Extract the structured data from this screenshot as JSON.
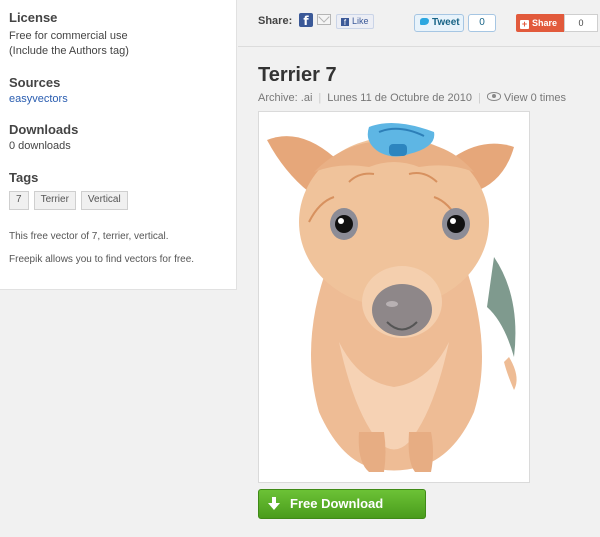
{
  "sidebar": {
    "license": {
      "heading": "License",
      "line1": "Free for commercial use",
      "line2": "(Include the Authors tag)"
    },
    "sources": {
      "heading": "Sources",
      "link": "easyvectors"
    },
    "downloads": {
      "heading": "Downloads",
      "count": "0 downloads"
    },
    "tags": {
      "heading": "Tags",
      "items": [
        "7",
        "Terrier",
        "Vertical"
      ]
    },
    "description": "This free vector of 7, terrier, vertical.",
    "promo": "Freepik allows you to find vectors for free."
  },
  "share": {
    "label": "Share:",
    "facebook_icon": "f",
    "like_label": "Like",
    "tweet_label": "Tweet",
    "tweet_count": "0",
    "gshare_label": "Share",
    "gshare_count": "0"
  },
  "item": {
    "title": "Terrier 7",
    "archive": "Archive: .ai",
    "date": "Lunes 11 de Octubre de 2010",
    "views": "View 0 times"
  },
  "download": {
    "label": "Free Download",
    "icon": "download-arrow-icon"
  },
  "colors": {
    "accent_green": "#5cb22a",
    "link_blue": "#2a5db0",
    "facebook_blue": "#3b5998",
    "google_red": "#e25a3c",
    "twitter_blue": "#2ba7e0"
  }
}
